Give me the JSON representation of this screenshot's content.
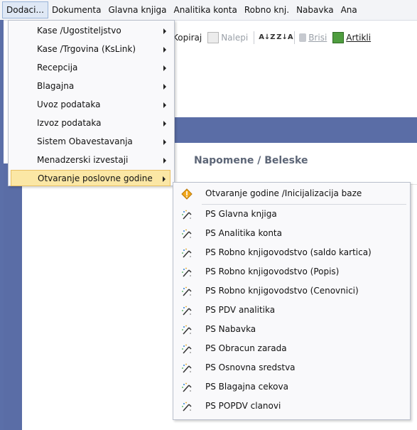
{
  "menubar": {
    "items": [
      {
        "label": "Dodaci..."
      },
      {
        "label": "Dokumenta"
      },
      {
        "label": "Glavna knjiga"
      },
      {
        "label": "Analitika konta"
      },
      {
        "label": "Robno knj."
      },
      {
        "label": "Nabavka"
      },
      {
        "label": "Ana"
      }
    ]
  },
  "toolbar": {
    "copy_label": "Kopiraj",
    "paste_label": "Nalepi",
    "sort_az_label": "A↓Z",
    "sort_za_label": "Z↓A",
    "delete_label": "Brisi",
    "articles_label": "Artikli"
  },
  "panel": {
    "title": "Napomene / Beleske"
  },
  "dropdown": {
    "items": [
      {
        "label": "Kase /Ugostiteljstvo",
        "has_submenu": true
      },
      {
        "label": "Kase /Trgovina (KsLink)",
        "has_submenu": true
      },
      {
        "label": "Recepcija",
        "has_submenu": true
      },
      {
        "label": "Blagajna",
        "has_submenu": true
      },
      {
        "label": "Uvoz podataka",
        "has_submenu": true
      },
      {
        "label": "Izvoz podataka",
        "has_submenu": true
      },
      {
        "label": "Sistem Obavestavanja",
        "has_submenu": true
      },
      {
        "label": "Menadzerski izvestaji",
        "has_submenu": true
      },
      {
        "label": "Otvaranje poslovne godine",
        "has_submenu": true,
        "highlighted": true
      }
    ]
  },
  "submenu": {
    "items": [
      {
        "label": "Otvaranje godine /Inicijalizacija baze",
        "icon": "warning-diamond-icon"
      },
      {
        "label": "PS Glavna knjiga",
        "icon": "wizard-icon"
      },
      {
        "label": "PS Analitika konta",
        "icon": "wizard-icon"
      },
      {
        "label": "PS Robno knjigovodstvo (saldo kartica)",
        "icon": "wizard-icon"
      },
      {
        "label": "PS Robno knjigovodstvo (Popis)",
        "icon": "wizard-icon"
      },
      {
        "label": "PS Robno knjigovodstvo (Cenovnici)",
        "icon": "wizard-icon"
      },
      {
        "label": "PS PDV analitika",
        "icon": "wizard-icon"
      },
      {
        "label": "PS Nabavka",
        "icon": "wizard-icon"
      },
      {
        "label": "PS Obracun zarada",
        "icon": "wizard-icon"
      },
      {
        "label": "PS Osnovna sredstva",
        "icon": "wizard-icon"
      },
      {
        "label": "PS Blagajna cekova",
        "icon": "wizard-icon"
      },
      {
        "label": "PS POPDV clanovi",
        "icon": "wizard-icon"
      }
    ]
  },
  "colors": {
    "accent_blue": "#5a6da6",
    "highlight": "#fbe7a5",
    "warning_icon": "#f2a81d"
  }
}
